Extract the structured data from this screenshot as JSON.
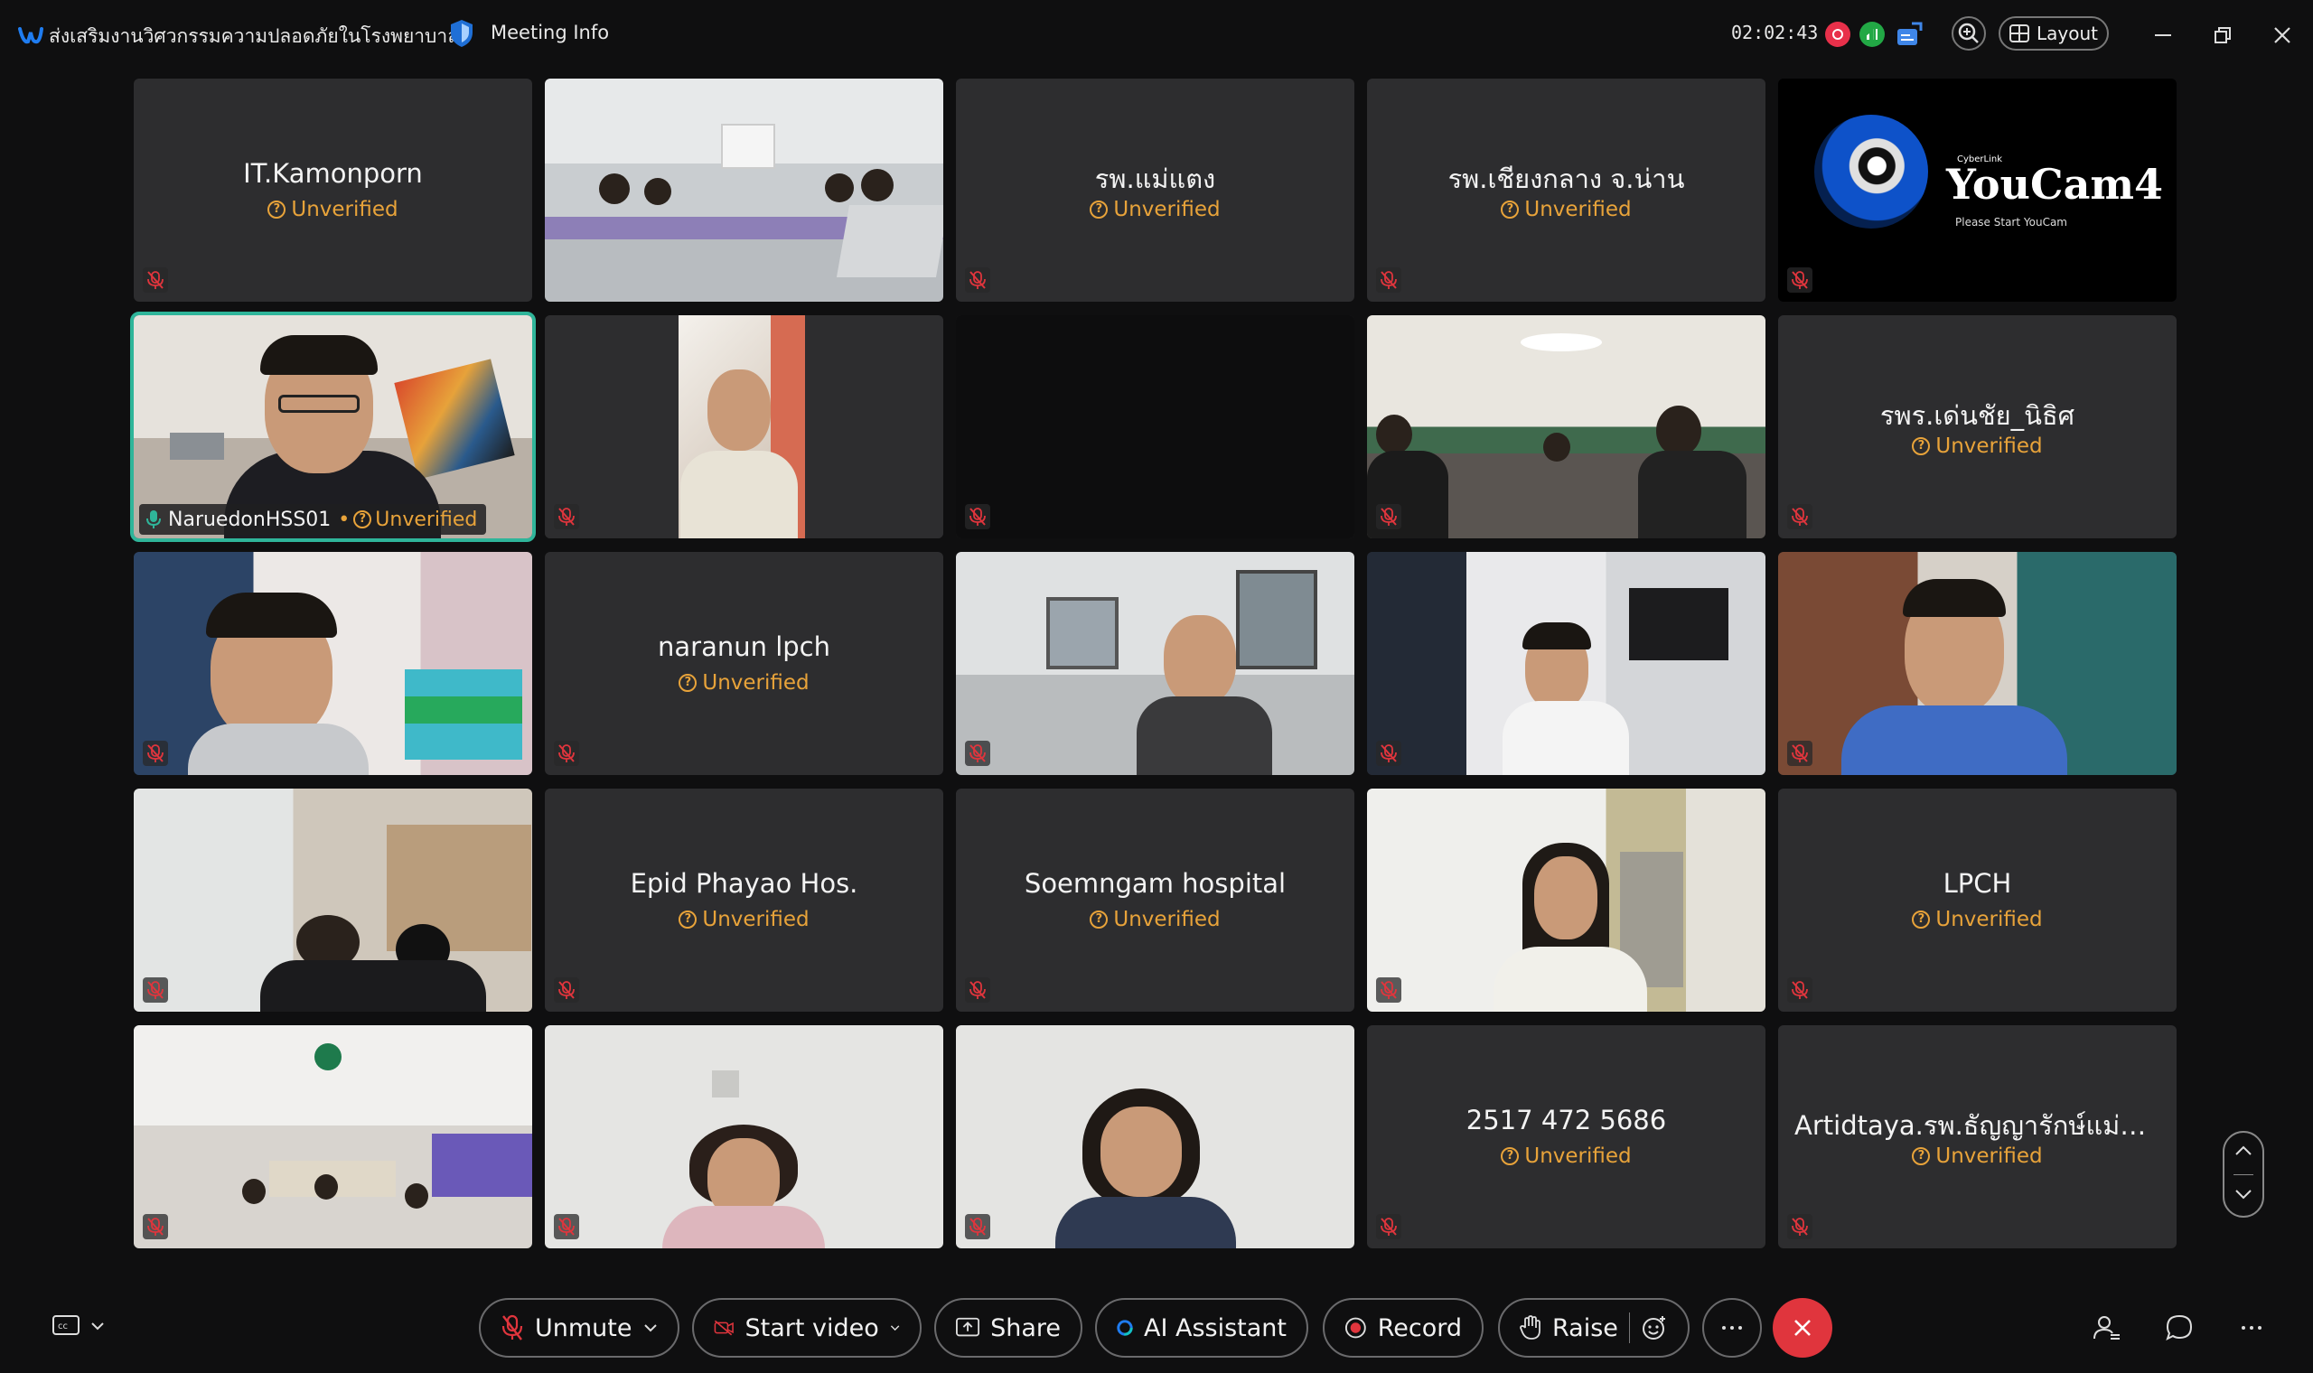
{
  "titlebar": {
    "meeting_title": "ส่งเสริมงานวิศวกรรมความปลอดภัยในโรงพยาบาล",
    "meeting_info": "Meeting Info",
    "timer": "02:02:43",
    "layout_label": "Layout"
  },
  "status_labels": {
    "unverified": "Unverified"
  },
  "tiles": [
    {
      "name": "IT.Kamonporn"
    },
    {
      "name": ""
    },
    {
      "name": "รพ.แม่แตง"
    },
    {
      "name": "รพ.เชียงกลาง จ.น่าน"
    },
    {
      "name": ""
    },
    {
      "name": "NaruedonHSS01"
    },
    {
      "name": ""
    },
    {
      "name": ""
    },
    {
      "name": ""
    },
    {
      "name": "รพร.เด่นชัย_นิธิศ"
    },
    {
      "name": ""
    },
    {
      "name": "naranun lpch"
    },
    {
      "name": ""
    },
    {
      "name": ""
    },
    {
      "name": ""
    },
    {
      "name": ""
    },
    {
      "name": "Epid Phayao Hos."
    },
    {
      "name": "Soemngam hospital"
    },
    {
      "name": ""
    },
    {
      "name": "LPCH"
    },
    {
      "name": ""
    },
    {
      "name": ""
    },
    {
      "name": ""
    },
    {
      "name": "2517 472 5686"
    },
    {
      "name": "Artidtaya.รพ.ธัญญารักษ์แม่ฮ่อ..."
    }
  ],
  "youcam": {
    "brand": "CyberLink",
    "title": "YouCam4",
    "subtitle": "Please Start YouCam"
  },
  "toolbar": {
    "unmute": "Unmute",
    "start_video": "Start video",
    "share": "Share",
    "ai_assistant": "AI Assistant",
    "record": "Record",
    "raise": "Raise"
  },
  "colors": {
    "accent_active": "#2fb59a",
    "unverified": "#e8a33a",
    "end_call": "#e0353d",
    "mute_icon": "#e0353d"
  }
}
